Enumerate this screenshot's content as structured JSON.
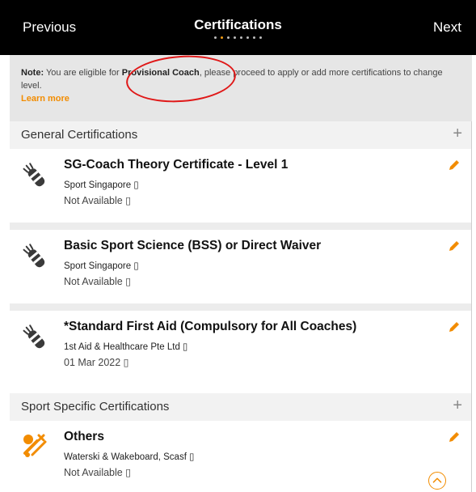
{
  "header": {
    "previous_label": "Previous",
    "title": "Certifications",
    "next_label": "Next",
    "steps_total": 8,
    "active_step": 2
  },
  "note": {
    "prefix": "Note:",
    "text_before": " You are eligible for ",
    "highlight": "Provisional Coach",
    "text_after": ", please proceed to apply or add more certifications to change level.",
    "learn_more": "Learn more"
  },
  "sections": {
    "general": {
      "label": "General Certifications",
      "items": [
        {
          "title": "SG-Coach Theory Certificate - Level 1",
          "organization": "Sport Singapore",
          "status": "Not Available"
        },
        {
          "title": "Basic Sport Science (BSS) or Direct Waiver",
          "organization": "Sport Singapore",
          "status": "Not Available"
        },
        {
          "title": "*Standard First Aid (Compulsory for All Coaches)",
          "organization": "1st Aid & Healthcare Pte Ltd",
          "status": "01 Mar 2022"
        }
      ]
    },
    "sport_specific": {
      "label": "Sport Specific Certifications",
      "items": [
        {
          "title": "Others",
          "organization": "Waterski & Wakeboard, Scasf",
          "status": "Not Available"
        }
      ]
    }
  },
  "icons": {
    "plus": "+",
    "info": "▯",
    "pencil": "pencil-icon",
    "certificate": "badge-icon",
    "sport": "sport-icon",
    "scroll_up": "chevron-up-icon"
  },
  "colors": {
    "accent": "#f28c00",
    "annotation": "#e01818",
    "header_bg": "#000000"
  }
}
